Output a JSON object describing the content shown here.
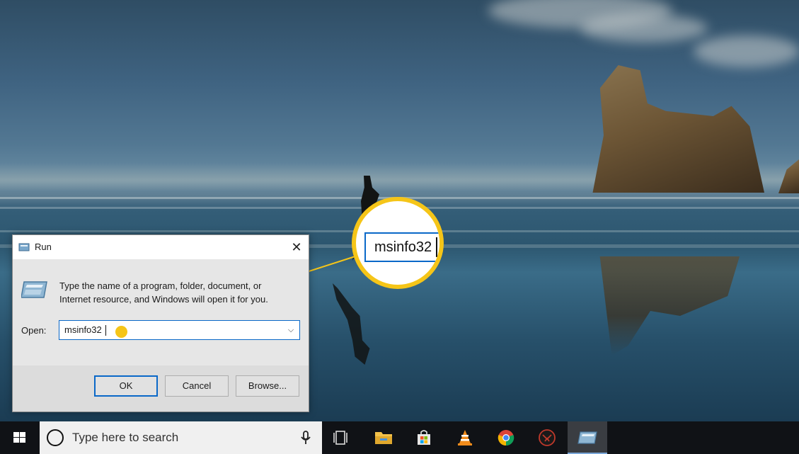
{
  "run_dialog": {
    "title": "Run",
    "description": "Type the name of a program, folder, document, or Internet resource, and Windows will open it for you.",
    "open_label": "Open:",
    "open_value": "msinfo32",
    "close_glyph": "✕",
    "dropdown_glyph": "⌵",
    "buttons": {
      "ok": "OK",
      "cancel": "Cancel",
      "browse": "Browse..."
    }
  },
  "callout": {
    "magnified_text": "msinfo32",
    "color": "#f5c518"
  },
  "taskbar": {
    "search_placeholder": "Type here to search",
    "pinned": [
      "task-view-icon",
      "file-explorer-icon",
      "microsoft-store-icon",
      "vlc-icon",
      "chrome-icon",
      "app-icon",
      "run-app-icon"
    ]
  },
  "colors": {
    "accent": "#0a68c8",
    "taskbar": "#101216",
    "dialog": "#e6e6e6"
  }
}
